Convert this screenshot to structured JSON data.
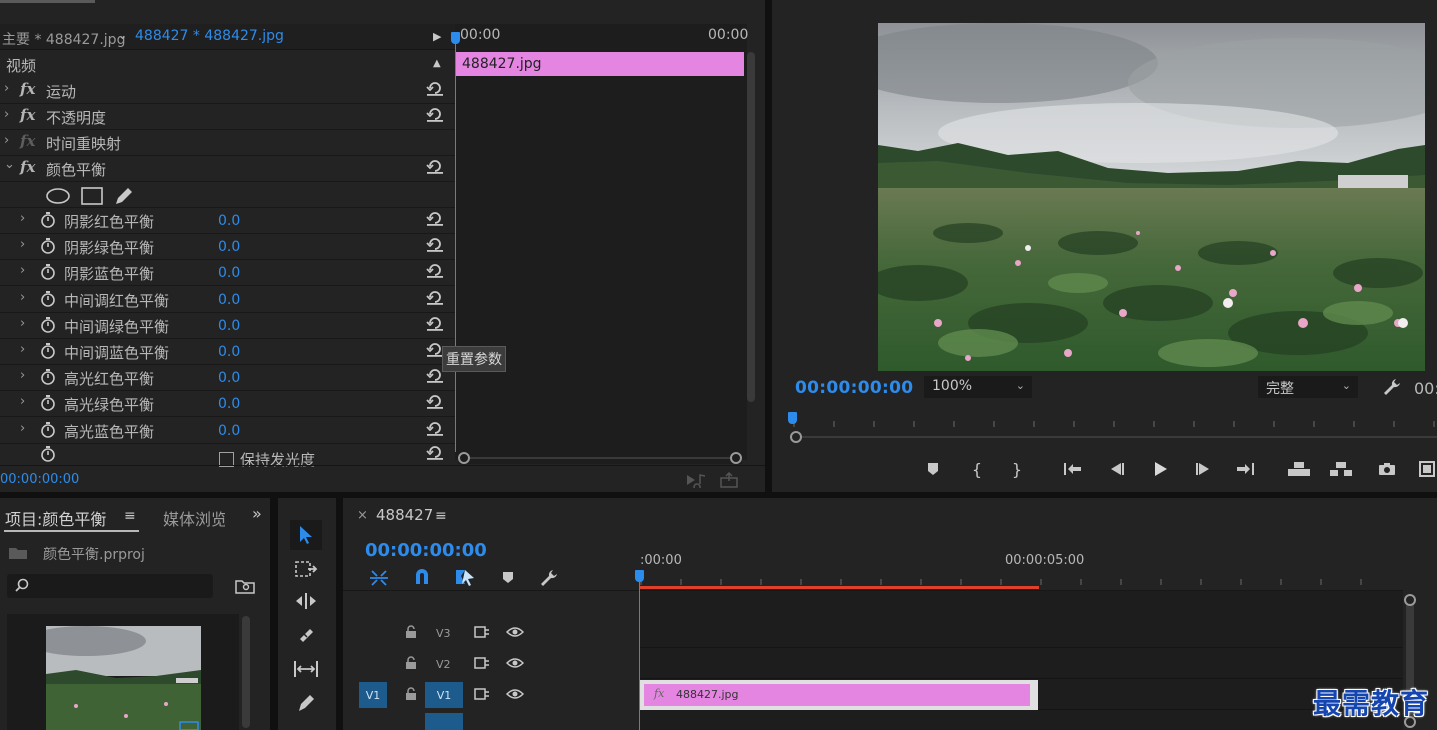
{
  "effect_controls": {
    "tab_main": "主要 * 488427.jpg",
    "tab_sequence": "488427 * 488427.jpg",
    "timecode_start": "00:00",
    "timecode_end": "00:00",
    "clip_name": "488427.jpg",
    "section_video": "视频",
    "effects": [
      {
        "label": "运动"
      },
      {
        "label": "不透明度"
      },
      {
        "label": "时间重映射"
      },
      {
        "label": "颜色平衡"
      }
    ],
    "params": [
      {
        "label": "阴影红色平衡",
        "value": "0.0"
      },
      {
        "label": "阴影绿色平衡",
        "value": "0.0"
      },
      {
        "label": "阴影蓝色平衡",
        "value": "0.0"
      },
      {
        "label": "中间调红色平衡",
        "value": "0.0"
      },
      {
        "label": "中间调绿色平衡",
        "value": "0.0"
      },
      {
        "label": "中间调蓝色平衡",
        "value": "0.0"
      },
      {
        "label": "高光红色平衡",
        "value": "0.0"
      },
      {
        "label": "高光绿色平衡",
        "value": "0.0"
      },
      {
        "label": "高光蓝色平衡",
        "value": "0.0"
      }
    ],
    "keep_luminance_label": "保持发光度",
    "tooltip": "重置参数",
    "bottom_timecode": "00:00:00:00"
  },
  "program_monitor": {
    "timecode": "00:00:00:00",
    "zoom": "100%",
    "quality": "完整",
    "timecode_right": "00:"
  },
  "project": {
    "tab_project": "项目:颜色平衡",
    "tab_media": "媒体浏览",
    "project_file": "颜色平衡.prproj"
  },
  "timeline": {
    "sequence_name": "488427",
    "timecode": "00:00:00:00",
    "ruler_start": ":00:00",
    "ruler_mid": "00:00:05:00",
    "tracks": [
      {
        "target": "V3"
      },
      {
        "target": "V2"
      },
      {
        "source": "V1",
        "target": "V1"
      }
    ],
    "clip_name": "488427.jpg",
    "fx_badge": "fx"
  },
  "watermark": "最需教育",
  "colors": {
    "accent_blue": "#2d8ceb",
    "clip_pink": "#e585e2",
    "work_area_red": "#e0402a"
  }
}
